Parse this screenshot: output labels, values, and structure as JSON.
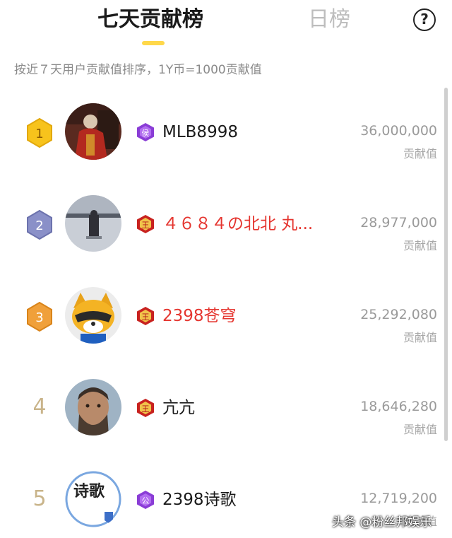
{
  "header": {
    "tab_active": "七天贡献榜",
    "tab_inactive": "日榜",
    "help_label": "?"
  },
  "subtitle": "按近７天用户贡献值排序，1Y币=1000贡献值",
  "colors": {
    "accent": "#ffd84a",
    "red_name": "#e5352f",
    "gold": "#f7c31c",
    "silver": "#8a90c8",
    "bronze": "#f0a03a",
    "badge_purple": "#8a3dd6",
    "badge_red": "#c8221f"
  },
  "leaderboard": [
    {
      "rank": "1",
      "rank_style": "gold-medal",
      "avatar": "joker-avatar",
      "badge_icon": "purple-hexagon-badge-icon",
      "badge_text": "侯",
      "name": "MLB8998",
      "name_color": "normal",
      "score": "36,000,000",
      "score_label": "贡献值"
    },
    {
      "rank": "2",
      "rank_style": "silver-medal",
      "avatar": "snow-figure-avatar",
      "badge_icon": "red-hexagon-badge-icon",
      "badge_text": "王",
      "name": "４６８４の北北 丸...",
      "name_color": "red",
      "score": "28,977,000",
      "score_label": "贡献值"
    },
    {
      "rank": "3",
      "rank_style": "bronze-medal",
      "avatar": "raccoon-mascot-avatar",
      "badge_icon": "red-hexagon-badge-icon",
      "badge_text": "王",
      "name": "2398苍穹",
      "name_color": "red",
      "score": "25,292,080",
      "score_label": "贡献值"
    },
    {
      "rank": "4",
      "rank_style": "plain",
      "avatar": "bearded-man-avatar",
      "badge_icon": "red-hexagon-badge-icon",
      "badge_text": "王",
      "name": "亢亢",
      "name_color": "normal",
      "score": "18,646,280",
      "score_label": "贡献值"
    },
    {
      "rank": "5",
      "rank_style": "plain",
      "avatar": "calligraphy-avatar",
      "badge_icon": "purple-hexagon-badge-icon",
      "badge_text": "公",
      "name": "2398诗歌",
      "name_color": "normal",
      "score": "12,719,200",
      "score_label": "贡献值"
    }
  ],
  "avatar_text": {
    "row5": "诗歌"
  },
  "watermark": "头条 @粉丝邦娱乐"
}
